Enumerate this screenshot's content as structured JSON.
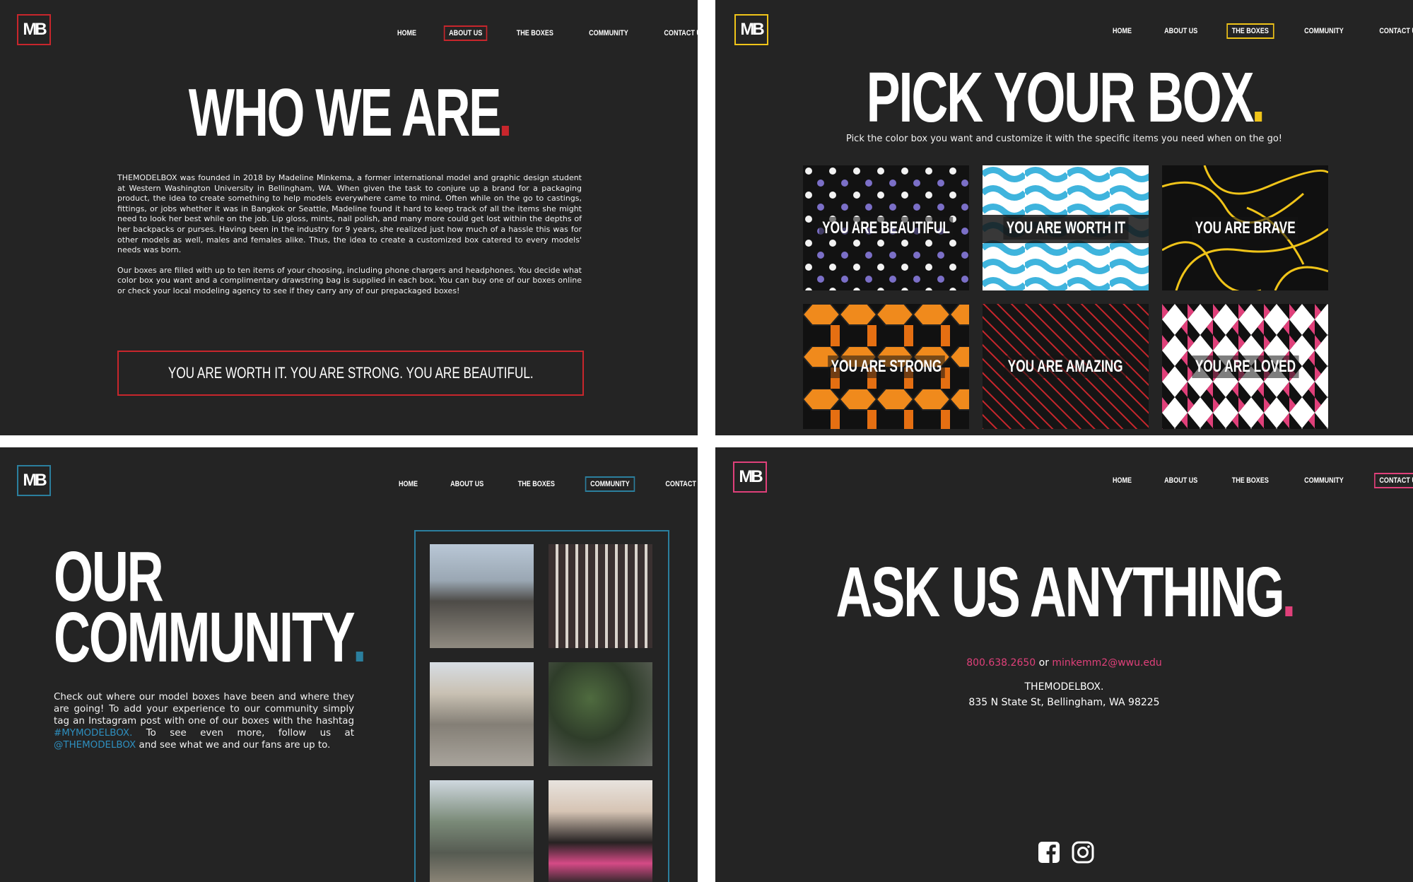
{
  "logo_text": "MB",
  "nav_items": [
    "HOME",
    "ABOUT US",
    "THE BOXES",
    "COMMUNITY",
    "CONTACT US"
  ],
  "colors": {
    "red": "#c8262c",
    "yellow": "#f0c419",
    "blue": "#2b7f9e",
    "pink": "#e0407a",
    "background": "#242424"
  },
  "about": {
    "active_nav": "ABOUT US",
    "title": "WHO WE ARE",
    "paragraph1": "THEMODELBOX was founded in 2018 by Madeline Minkema, a former international model and graphic design student at Western Washington University in Bellingham, WA. When given the task to conjure up a brand for a packaging product, the idea to create something to help models everywhere came to mind. Often while on the go to castings, fittings, or jobs whether it was in Bangkok or Seattle, Madeline found it hard to keep track of all the items she might need to look her best while on the job. Lip gloss, mints, nail polish, and many more could get lost within the depths of her backpacks or purses. Having been in the industry for 9 years, she realized just how much of a hassle this was for other models as well, males and females alike. Thus, the idea to create a customized box catered to every models' needs was born.",
    "paragraph2": "Our boxes are filled with up to ten items of your choosing, including phone chargers and headphones. You decide what color box you want and a complimentary drawstring bag is supplied in each box. You can buy one of our boxes online or check your local modeling agency to see if they carry any of our prepackaged boxes!",
    "motto": "YOU ARE WORTH IT. YOU ARE STRONG. YOU ARE BEAUTIFUL."
  },
  "boxes": {
    "active_nav": "THE BOXES",
    "title": "PICK YOUR BOX",
    "subtitle": "Pick the color box you want and customize it with the specific items you need when on the go!",
    "tiles": [
      {
        "caption": "YOU ARE BEAUTIFUL",
        "pattern": "polka-dots",
        "accent": "#7b6fc7"
      },
      {
        "caption": "YOU ARE WORTH IT",
        "pattern": "waves",
        "accent": "#3fb4dd"
      },
      {
        "caption": "YOU ARE BRAVE",
        "pattern": "yellow-lines",
        "accent": "#f0c419"
      },
      {
        "caption": "YOU ARE STRONG",
        "pattern": "hexagons",
        "accent": "#f08a1c"
      },
      {
        "caption": "YOU ARE AMAZING",
        "pattern": "diagonal-stripes",
        "accent": "#c8262c"
      },
      {
        "caption": "YOU ARE LOVED",
        "pattern": "argyle",
        "accent": "#e0407a"
      }
    ]
  },
  "community": {
    "active_nav": "COMMUNITY",
    "title_line1": "OUR",
    "title_line2": "COMMUNITY",
    "text1": "Check out where our model boxes have been and where they are going! To add your experience to our community simply tag an Instagram post with one of our boxes with the hashtag ",
    "hashtag": "#MYMODELBOX.",
    "text2": " To see even more, follow us at ",
    "handle": "@THEMODELBOX",
    "text3": " and see what we and our fans are up to.",
    "photos": [
      "colonnade-building-photo",
      "ornate-facade-photo",
      "palace-plaza-photo",
      "park-path-photo",
      "street-photo",
      "group-portrait-photo"
    ]
  },
  "contact": {
    "active_nav": "CONTACT US",
    "title": "ASK US ANYTHING",
    "phone": "800.638.2650",
    "or": "or",
    "email": "minkemm2@wwu.edu",
    "company": "THEMODELBOX.",
    "address": "835 N State St, Bellingham, WA 98225",
    "social_icons": [
      "facebook-icon",
      "instagram-icon"
    ]
  }
}
